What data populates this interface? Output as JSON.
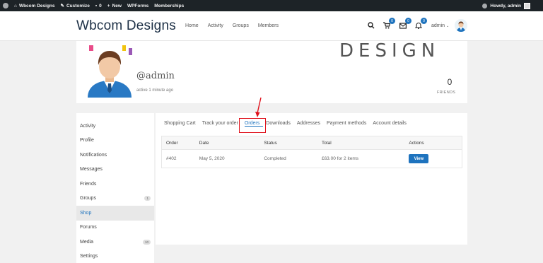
{
  "adminbar": {
    "site_name": "Wbcom Designs",
    "customize": "Customize",
    "comments_count": "0",
    "new_label": "New",
    "wpforms": "WPForms",
    "memberships": "Memberships",
    "howdy": "Howdy, admin"
  },
  "header": {
    "logo": "Wbcom Designs",
    "nav": [
      "Home",
      "Activity",
      "Groups",
      "Members"
    ],
    "cart_count": "0",
    "messages_count": "0",
    "notifications_count": "0",
    "user_label": "admin"
  },
  "profile": {
    "cover_word": "DESIGN",
    "handle": "@admin",
    "active": "active 1 minute ago",
    "friends_count": "0",
    "friends_label": "FRIENDS"
  },
  "sidebar": {
    "items": [
      {
        "label": "Activity",
        "count": ""
      },
      {
        "label": "Profile",
        "count": ""
      },
      {
        "label": "Notifications",
        "count": ""
      },
      {
        "label": "Messages",
        "count": ""
      },
      {
        "label": "Friends",
        "count": ""
      },
      {
        "label": "Groups",
        "count": "1"
      },
      {
        "label": "Shop",
        "count": ""
      },
      {
        "label": "Forums",
        "count": ""
      },
      {
        "label": "Media",
        "count": "10"
      },
      {
        "label": "Settings",
        "count": ""
      }
    ],
    "active": "Shop"
  },
  "shop": {
    "tabs": [
      "Shopping Cart",
      "Track your order",
      "Orders",
      "Downloads",
      "Addresses",
      "Payment methods",
      "Account details"
    ],
    "active_tab": "Orders",
    "columns": [
      "Order",
      "Date",
      "Status",
      "Total",
      "Actions"
    ],
    "rows": [
      {
        "order": "#402",
        "date": "May 5, 2020",
        "status": "Completed",
        "total": "£63.00 for 2 items",
        "action": "View"
      }
    ]
  },
  "colors": {
    "accent": "#1e73be",
    "annotation": "#e0111b",
    "adminbar": "#1d2327"
  }
}
